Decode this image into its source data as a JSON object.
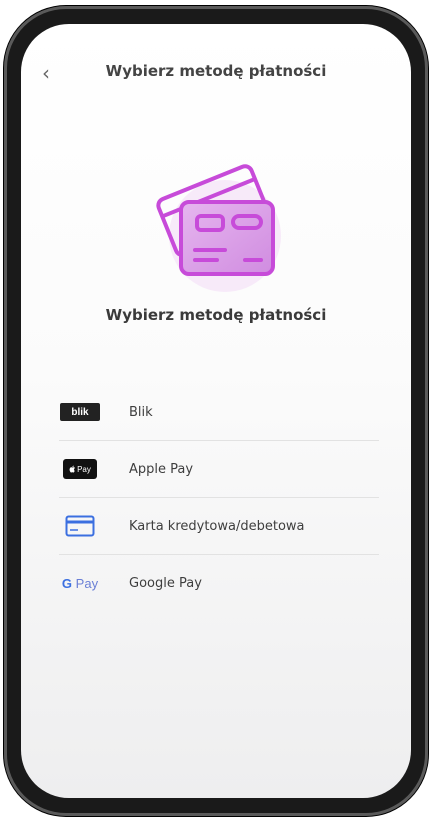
{
  "header": {
    "back_glyph": "‹",
    "title": "Wybierz metodę płatności"
  },
  "hero": {
    "icon": "credit-cards-icon",
    "title": "Wybierz metodę płatności",
    "accent": "#c74bd9"
  },
  "methods": [
    {
      "id": "blik",
      "label": "Blik",
      "logo_text": "blik",
      "icon": "blik-logo"
    },
    {
      "id": "apple-pay",
      "label": "Apple Pay",
      "logo_text": "Pay",
      "icon": "apple-pay-logo"
    },
    {
      "id": "card",
      "label": "Karta kredytowa/debetowa",
      "icon": "credit-card-icon",
      "accent": "#3b6fe0"
    },
    {
      "id": "google-pay",
      "label": "Google Pay",
      "logo_g": "G",
      "logo_pay": "Pay",
      "icon": "google-pay-logo"
    }
  ]
}
